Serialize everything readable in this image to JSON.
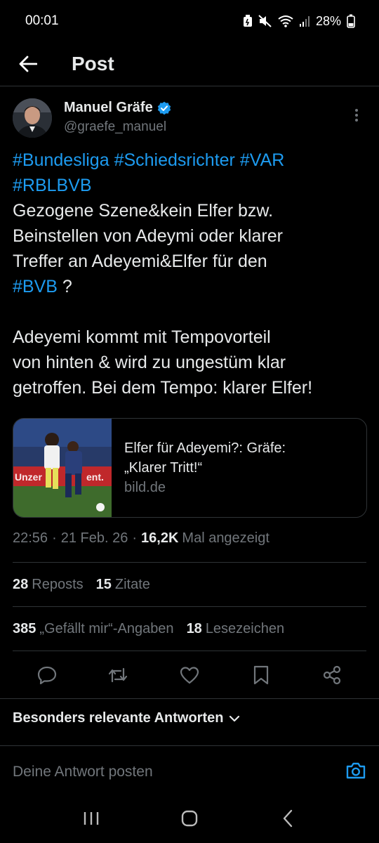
{
  "status_bar": {
    "time": "00:01",
    "battery": "28%"
  },
  "header": {
    "title": "Post"
  },
  "author": {
    "name": "Manuel Gräfe",
    "handle": "@graefe_manuel",
    "verified_color": "#1d9bf0"
  },
  "tweet": {
    "line1_tag1": "#Bundesliga",
    "line1_tag2": "#Schiedsrichter",
    "line1_tag3": "#VAR",
    "line2_tag": "#RBLBVB",
    "line3": "Gezogene Szene&kein Elfer bzw.",
    "line4": "Beinstellen von Adeymi oder klarer",
    "line5": "Treffer an Adeyemi&Elfer für den",
    "line6_tag": "#BVB",
    "line6_rest": " ?",
    "line7": "Adeyemi kommt mit Tempovorteil",
    "line8": "von hinten & wird zu ungestüm klar",
    "line9": "getroffen. Bei dem Tempo: klarer Elfer!"
  },
  "link_card": {
    "title_line1": "Elfer für Adeyemi?: Gräfe:",
    "title_line2": "„Klarer Tritt!“",
    "domain": "bild.de"
  },
  "meta": {
    "time": "22:56",
    "date": "21 Feb. 26",
    "views": "16,2K",
    "views_label": "Mal angezeigt"
  },
  "stats_row1": {
    "reposts": "28",
    "reposts_label": "Reposts",
    "quotes": "15",
    "quotes_label": "Zitate"
  },
  "stats_row2": {
    "likes": "385",
    "likes_label": "„Gefällt mir“-Angaben",
    "bookmarks": "18",
    "bookmarks_label": "Lesezeichen"
  },
  "actions": [
    "reply-icon",
    "repost-icon",
    "like-icon",
    "bookmark-icon",
    "share-icon"
  ],
  "replies": {
    "sort_label": "Besonders relevante Antworten"
  },
  "reply_bar": {
    "placeholder": "Deine Antwort posten"
  },
  "colors": {
    "accent": "#1d9bf0",
    "text": "#e7e9ea",
    "muted": "#71767b",
    "divider": "#2f3336"
  }
}
